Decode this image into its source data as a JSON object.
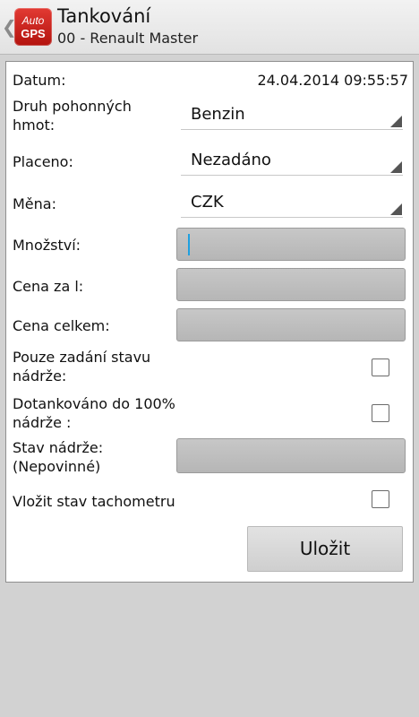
{
  "header": {
    "logo_line1": "Auto",
    "logo_line2": "GPS",
    "title": "Tankování",
    "subtitle": "00 - Renault Master"
  },
  "form": {
    "date_label": "Datum:",
    "date_value": "24.04.2014 09:55:57",
    "fuel_type_label": "Druh pohonných hmot:",
    "fuel_type_value": "Benzin",
    "paid_label": "Placeno:",
    "paid_value": "Nezadáno",
    "currency_label": "Měna:",
    "currency_value": "CZK",
    "quantity_label": "Množství:",
    "quantity_value": "",
    "price_per_l_label": "Cena za l:",
    "price_per_l_value": "",
    "total_price_label": "Cena celkem:",
    "total_price_value": "",
    "tank_state_only_label": "Pouze zadání stavu nádrže:",
    "tank_state_only_checked": false,
    "refuel_full_label": "Dotankováno do 100% nádrže :",
    "refuel_full_checked": false,
    "tank_state_label": "Stav nádrže: (Nepovinné)",
    "tank_state_value": "",
    "odometer_label": "Vložit stav tachometru",
    "odometer_checked": false,
    "save_label": "Uložit"
  },
  "icons": {
    "back": "chevron-left-icon",
    "logo": "autogps-logo",
    "dropdown": "dropdown-triangle-icon"
  },
  "colors": {
    "logo_red": "#c9241d",
    "cursor_blue": "#1ea0e0",
    "field_gray": "#bdbdbd",
    "background": "#d2d2d2"
  }
}
